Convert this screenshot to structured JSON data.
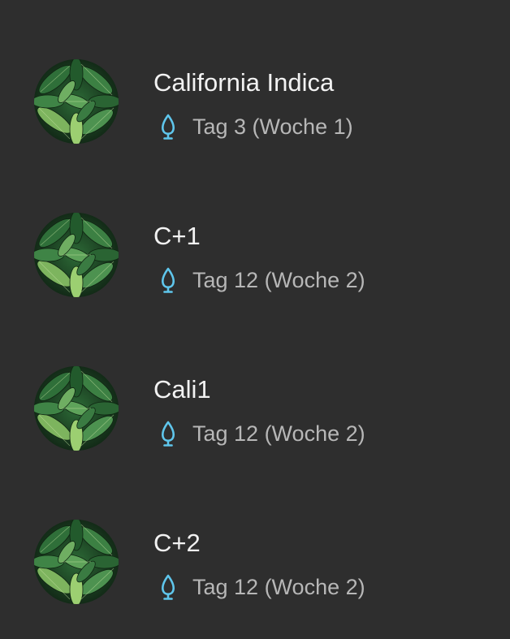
{
  "colors": {
    "background": "#2e2e2e",
    "name_text": "#f2f2f2",
    "meta_text": "#b7b7b7",
    "stage_icon": "#5fc6ec",
    "leaf_dark": "#1f4b27",
    "leaf_light": "#9ccf71"
  },
  "plants": [
    {
      "name": "California Indica",
      "age": "Tag 3 (Woche 1)",
      "avatar_icon": "leaf-photo-icon",
      "stage_icon": "seed-stage-icon"
    },
    {
      "name": "C+1",
      "age": "Tag 12 (Woche 2)",
      "avatar_icon": "leaf-photo-icon",
      "stage_icon": "seed-stage-icon"
    },
    {
      "name": "Cali1",
      "age": "Tag 12 (Woche 2)",
      "avatar_icon": "leaf-photo-icon",
      "stage_icon": "seed-stage-icon"
    },
    {
      "name": "C+2",
      "age": "Tag 12 (Woche 2)",
      "avatar_icon": "leaf-photo-icon",
      "stage_icon": "seed-stage-icon"
    }
  ]
}
